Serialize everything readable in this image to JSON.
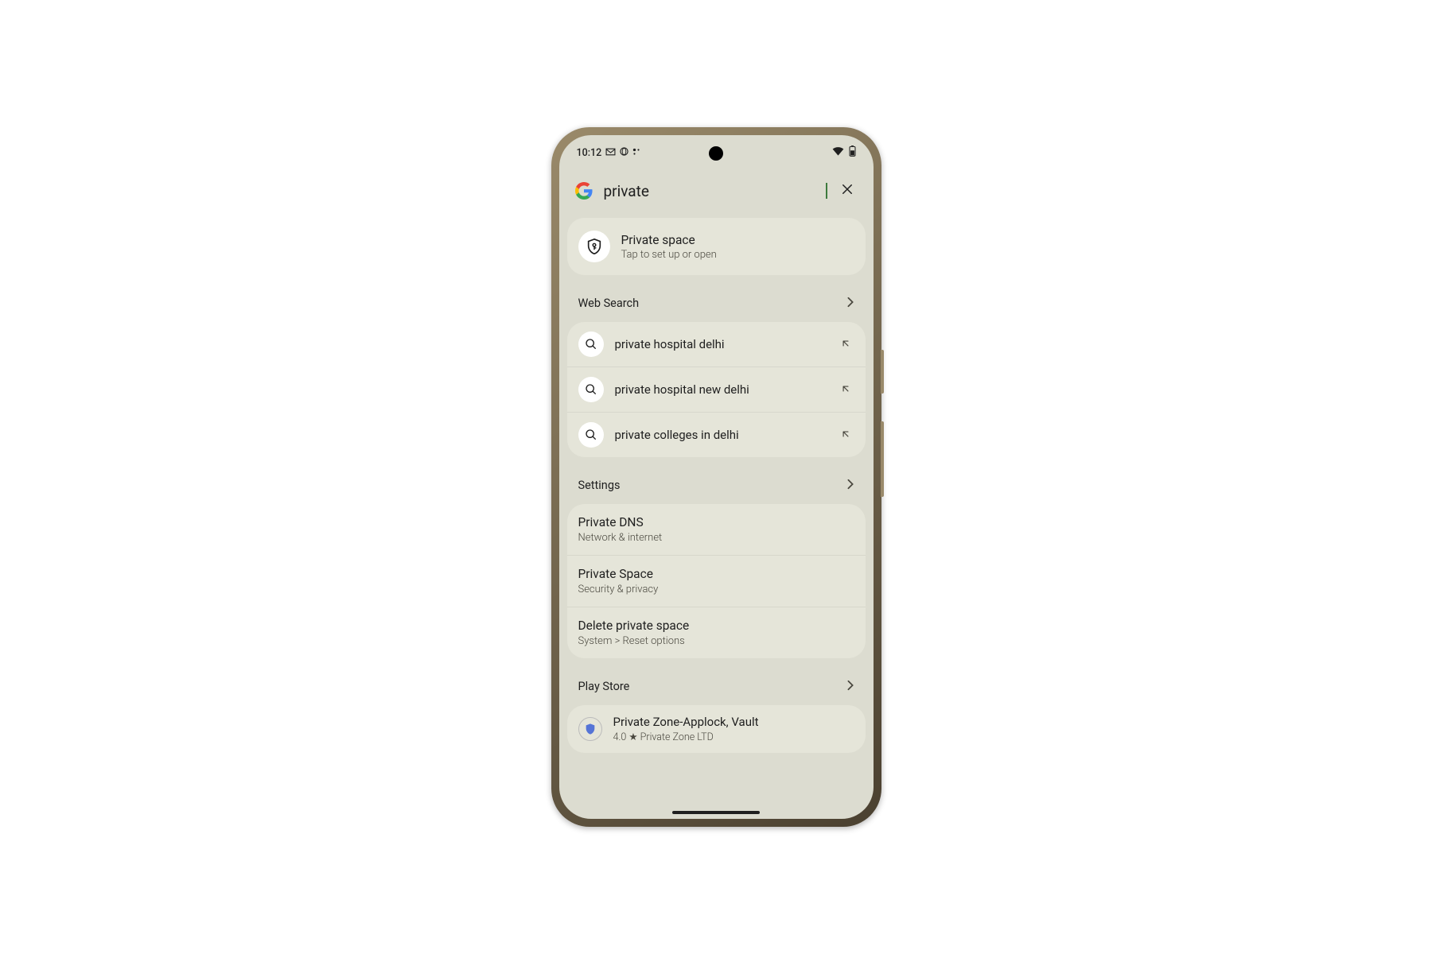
{
  "status_bar": {
    "time": "10:12"
  },
  "search": {
    "query": "private"
  },
  "feature": {
    "title": "Private space",
    "subtitle": "Tap to set up or open"
  },
  "sections": {
    "web_search": {
      "label": "Web Search",
      "suggestions": [
        "private hospital delhi",
        "private hospital new delhi",
        "private colleges in delhi"
      ]
    },
    "settings": {
      "label": "Settings",
      "items": [
        {
          "title": "Private DNS",
          "subtitle": "Network & internet"
        },
        {
          "title": "Private Space",
          "subtitle": "Security & privacy"
        },
        {
          "title": "Delete private space",
          "subtitle": "System > Reset options"
        }
      ]
    },
    "play_store": {
      "label": "Play Store",
      "items": [
        {
          "title": "Private Zone-Applock, Vault",
          "subtitle": "4.0 ★ Private Zone LTD"
        }
      ]
    }
  }
}
